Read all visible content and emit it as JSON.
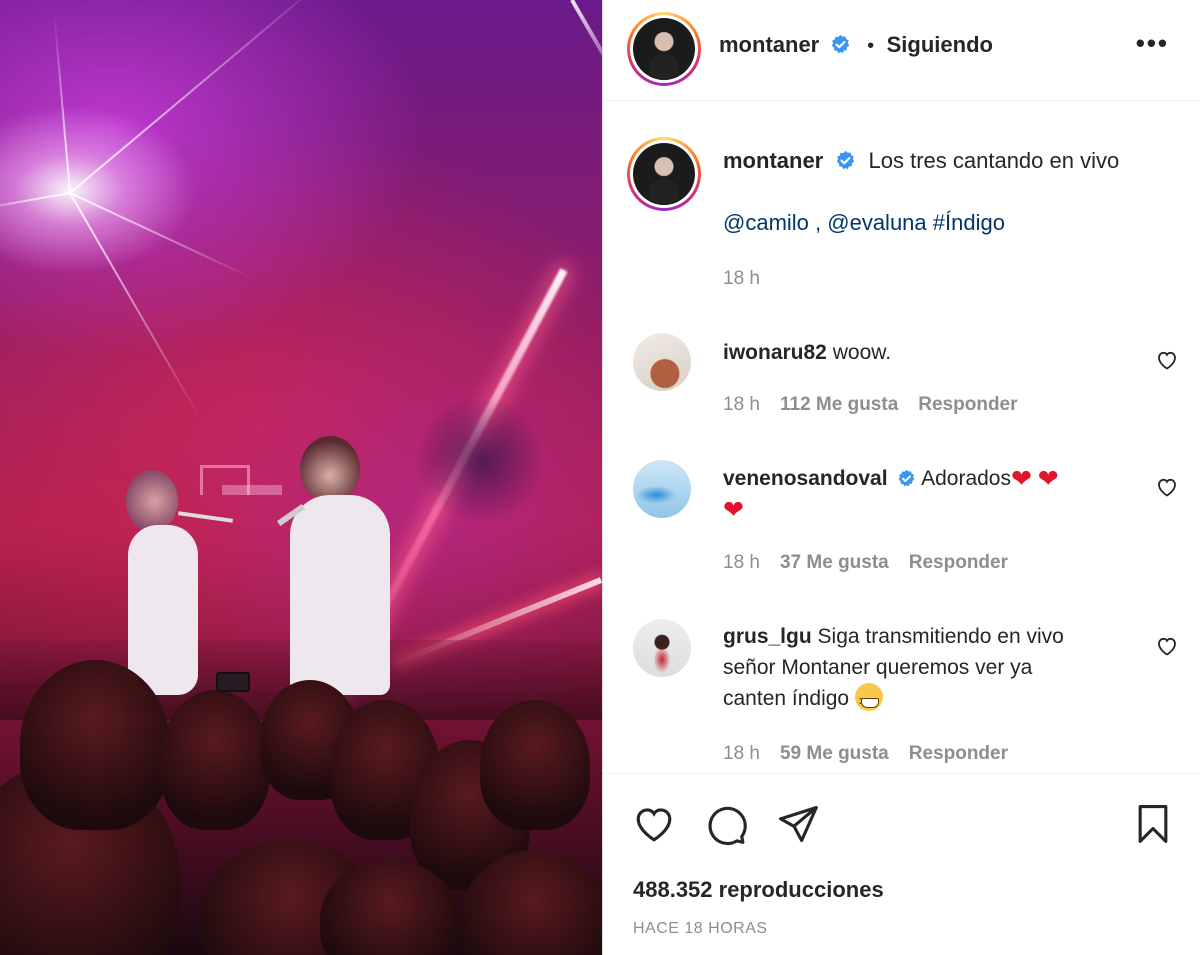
{
  "post": {
    "author": "montaner",
    "follow_status": "Siguiendo",
    "dot": "•",
    "more": "•••"
  },
  "caption": {
    "author": "montaner",
    "text": "Los tres cantando en vivo",
    "mention1": "@camilo",
    "sep": " , ",
    "mention2": "@evaluna",
    "hashtag": "#Índigo",
    "time": "18 h"
  },
  "comments": [
    {
      "user": "iwonaru82",
      "text": "woow.",
      "time": "18 h",
      "likes": "112 Me gusta",
      "reply": "Responder"
    },
    {
      "user": "venenosandoval",
      "text": "Adorados",
      "time": "18 h",
      "likes": "37 Me gusta",
      "reply": "Responder"
    },
    {
      "user": "grus_lgu",
      "text_line1": "Siga transmitiendo en vivo",
      "text_line2": "señor Montaner queremos ver ya",
      "text_line3": "canten índigo",
      "time": "18 h",
      "likes": "59 Me gusta",
      "reply": "Responder"
    }
  ],
  "footer": {
    "views": "488.352 reproducciones",
    "ago": "HACE 18 HORAS"
  },
  "icons": {
    "verified": "verified-badge-icon",
    "heart": "heart-icon",
    "comment": "comment-icon",
    "share": "share-icon",
    "save": "bookmark-icon",
    "more": "more-options-icon"
  },
  "colors": {
    "verified": "#3897f0",
    "link": "#00376b",
    "muted": "#8e8e8e",
    "text": "#262626"
  }
}
